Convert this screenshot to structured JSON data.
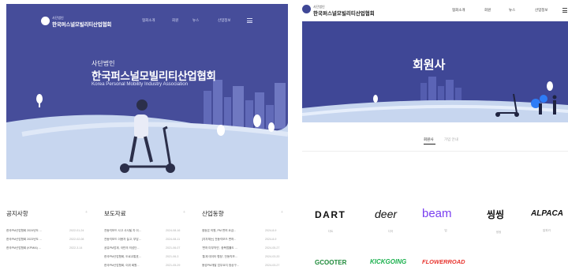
{
  "left": {
    "logo": {
      "small": "사단법인",
      "big": "한국퍼스널모빌리티산업협회"
    },
    "nav": [
      "협회소개",
      "회원",
      "뉴스",
      "산업정보"
    ],
    "hero": {
      "kicker": "사단법인",
      "title": "한국퍼스널모빌리티산업협회",
      "subtitle": "Korea Personal Mobility Industry Association"
    },
    "sections": [
      {
        "title": "공지사항",
        "more": "+",
        "rows": [
          {
            "text": "한국PM산업협회 2024년도 ...",
            "date": "2022-01-24"
          },
          {
            "text": "한국PM산업협회 2023년도 ...",
            "date": "2022-02-08"
          },
          {
            "text": "한국PM산업협회 (KPMIA) ...",
            "date": "2022-3-14"
          }
        ]
      },
      {
        "title": "보도자료",
        "more": "+",
        "rows": [
          {
            "text": "전동킥보드 사고 사사될 지 이...",
            "date": "2024-08-16"
          },
          {
            "text": "전동킥보드 이용자 늘고, 부담...",
            "date": "2024-08-11"
          },
          {
            "text": "공유PM업계, 국민의 의성단...",
            "date": "2021-06-07"
          },
          {
            "text": "한국PM산업협회, 도로교통표...",
            "date": "2021-06-3"
          },
          {
            "text": "한국PM산업협회, 이위 회원...",
            "date": "2021-05-29"
          }
        ]
      },
      {
        "title": "산업동향",
        "more": "+",
        "rows": [
          {
            "text": "점등은 의원, PM 면허 요금...",
            "date": "2024-8-9"
          },
          {
            "text": "[지자체는] 전동킥보드 면허...",
            "date": "2024-8-9"
          },
          {
            "text": "'면허 미부착인', 중복법률도 ...",
            "date": "2024-05-27"
          },
          {
            "text": "'통계 데이터 협정', 전동킥보...",
            "date": "2024-03-20"
          },
          {
            "text": "용성PM개발 업무요지 정상구...",
            "date": "2024-03-27"
          }
        ]
      }
    ]
  },
  "right": {
    "logo": {
      "small": "사단법인",
      "big": "한국퍼스널모빌리티산업협회"
    },
    "nav": [
      "협회소개",
      "회원",
      "뉴스",
      "산업정보"
    ],
    "banner_title": "회원사",
    "tabs": [
      {
        "label": "회원사",
        "active": true
      },
      {
        "label": "가입 안내",
        "active": false
      }
    ],
    "members": [
      {
        "logo": "DART",
        "caption": "다트",
        "color": "#111111"
      },
      {
        "logo": "deer",
        "caption": "디어",
        "color": "#111111"
      },
      {
        "logo": "beam",
        "caption": "빔",
        "color": "#7a3ff0"
      },
      {
        "logo": "씽씽",
        "caption": "씽씽",
        "color": "#111111"
      },
      {
        "logo": "ALPACA",
        "caption": "알파카",
        "color": "#111111"
      },
      {
        "logo": "GCOOTER",
        "caption": "",
        "color": "#1f8a3a"
      },
      {
        "logo": "KICKGOING",
        "caption": "",
        "color": "#1ab04d"
      },
      {
        "logo": "FLOWERROAD",
        "caption": "",
        "color": "#e8352f"
      }
    ]
  },
  "colors": {
    "hero_bg": "#464d9a",
    "road": "#c7d6ef",
    "banner_bg": "#3f4796",
    "accent": "#7a3ff0"
  }
}
